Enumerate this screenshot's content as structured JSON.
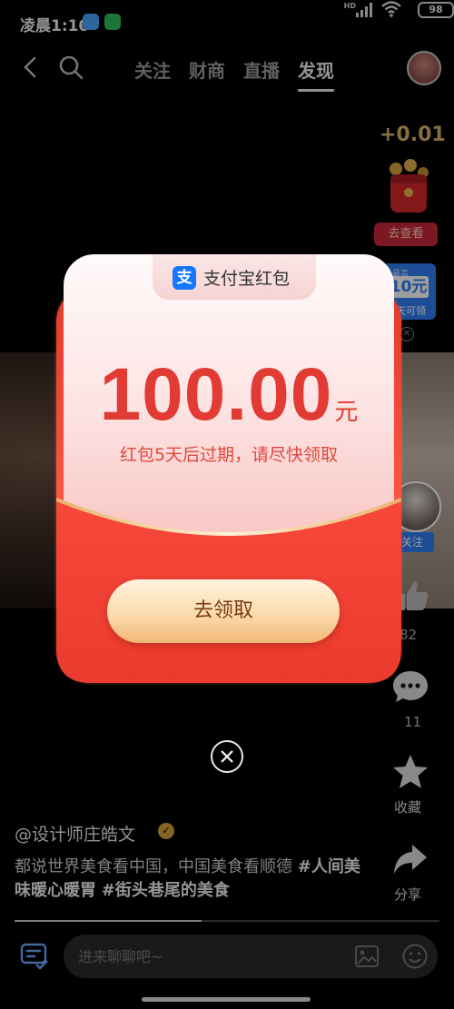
{
  "status_bar": {
    "time": "凌晨1:10",
    "hd": "HD",
    "battery": "98"
  },
  "top_nav": {
    "tabs": [
      {
        "label": "关注",
        "active": false
      },
      {
        "label": "财商",
        "active": false
      },
      {
        "label": "直播",
        "active": false
      },
      {
        "label": "发现",
        "active": true
      }
    ]
  },
  "side_rewards": {
    "amount": "+0.01",
    "button_label": "去查看",
    "coupon_top": "最高",
    "coupon_value": "10元",
    "coupon_bottom": "天可领"
  },
  "side_actions": {
    "follow_label": "关注",
    "like_count": "82",
    "comment_count": "11",
    "favorite_label": "收藏",
    "share_label": "分享"
  },
  "caption": {
    "author": "@设计师庄皓文",
    "text_plain": "都说世界美食看中国，中国美食看顺德 ",
    "tag1": "#人间美味暖心暖胃",
    "tag2": "#街头巷尾的美食"
  },
  "video_progress": 0.44,
  "chat": {
    "placeholder": "进来聊聊吧~"
  },
  "red_packet": {
    "brand": "支付宝红包",
    "brand_icon": "支",
    "amount": "100.00",
    "unit": "元",
    "expiry_text": "红包5天后过期，请尽快领取",
    "claim_label": "去领取"
  },
  "colors": {
    "packet_red": "#e23b33",
    "alipay_blue": "#1677ff",
    "claim_gold": "#fbd8a8"
  }
}
